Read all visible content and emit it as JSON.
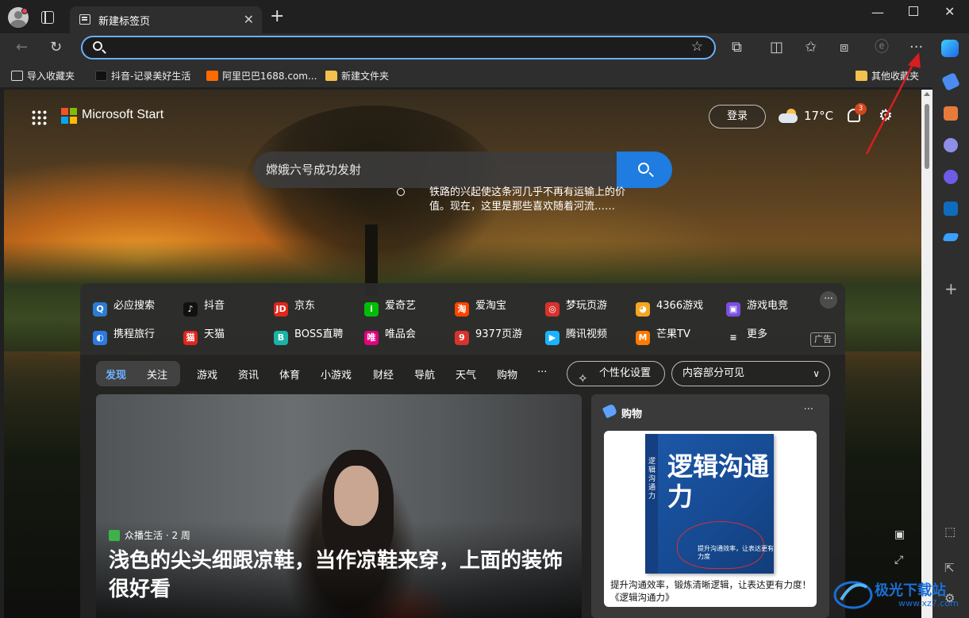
{
  "tab": {
    "title": "新建标签页"
  },
  "address_bar": {
    "value": "",
    "placeholder": ""
  },
  "bookmarks": [
    {
      "label": "导入收藏夹",
      "icon": "import-icon"
    },
    {
      "label": "抖音-记录美好生活",
      "icon": "tiktok-icon"
    },
    {
      "label": "阿里巴巴1688.com...",
      "icon": "alibaba-icon"
    },
    {
      "label": "新建文件夹",
      "icon": "folder-icon"
    },
    {
      "label": "其他收藏夹",
      "icon": "folder-icon"
    }
  ],
  "newtab": {
    "brand": "Microsoft Start",
    "login_label": "登录",
    "temperature": "17°C",
    "notification_count": "3",
    "search_placeholder": "嫦娥六号成功发射",
    "image_caption": "铁路的兴起使这条河几乎不再有运输上的价值。现在，这里是那些喜欢随着河流……"
  },
  "quicklinks": {
    "row1": [
      {
        "label": "必应搜索",
        "color": "#2b7cd3",
        "glyph": "Q"
      },
      {
        "label": "抖音",
        "color": "#111111",
        "glyph": "♪"
      },
      {
        "label": "京东",
        "color": "#e1251b",
        "glyph": "JD"
      },
      {
        "label": "爱奇艺",
        "color": "#00be06",
        "glyph": "i"
      },
      {
        "label": "爱淘宝",
        "color": "#ff4400",
        "glyph": "淘"
      },
      {
        "label": "梦玩页游",
        "color": "#d8322d",
        "glyph": "◎"
      },
      {
        "label": "4366游戏",
        "color": "#f5a623",
        "glyph": "◕"
      },
      {
        "label": "游戏电竞",
        "color": "#7b4fe0",
        "glyph": "▣"
      }
    ],
    "row2": [
      {
        "label": "携程旅行",
        "color": "#2a7ae2",
        "glyph": "◐"
      },
      {
        "label": "天猫",
        "color": "#e1251b",
        "glyph": "猫"
      },
      {
        "label": "BOSS直聘",
        "color": "#18b4a6",
        "glyph": "B"
      },
      {
        "label": "唯品会",
        "color": "#e4007f",
        "glyph": "唯"
      },
      {
        "label": "9377页游",
        "color": "#d8322d",
        "glyph": "9"
      },
      {
        "label": "腾讯视频",
        "color": "#1ab3ff",
        "glyph": "▶"
      },
      {
        "label": "芒果TV",
        "color": "#ff7a00",
        "glyph": "M"
      },
      {
        "label": "更多",
        "color": "transparent",
        "glyph": "≡"
      }
    ],
    "ad_label": "广告",
    "more_label": "···"
  },
  "feed": {
    "tab_active": "发现",
    "tab_follow": "关注",
    "categories": [
      "游戏",
      "资讯",
      "体育",
      "小游戏",
      "财经",
      "导航",
      "天气",
      "购物",
      "···"
    ],
    "personalize_label": "个性化设置",
    "visibility_label": "内容部分可见",
    "hero": {
      "source": "众播生活 · 2 周",
      "title": "浅色的尖头细跟凉鞋，当作凉鞋来穿，上面的装饰很好看"
    },
    "shopping": {
      "title": "购物",
      "more_label": "···",
      "book_title": "逻辑沟通力",
      "book_spine": "逻辑沟通力",
      "book_blurb": "提升沟通效率，让表达更有力度",
      "description": "提升沟通效率，锻炼清晰逻辑，让表达更有力度！《逻辑沟通力》"
    }
  },
  "watermark": {
    "main": "极光下载站",
    "sub": "www.xz7.com"
  },
  "colors": {
    "accent": "#1f7ce0",
    "address_focus": "#6aaefc",
    "badge": "#d4451f"
  }
}
